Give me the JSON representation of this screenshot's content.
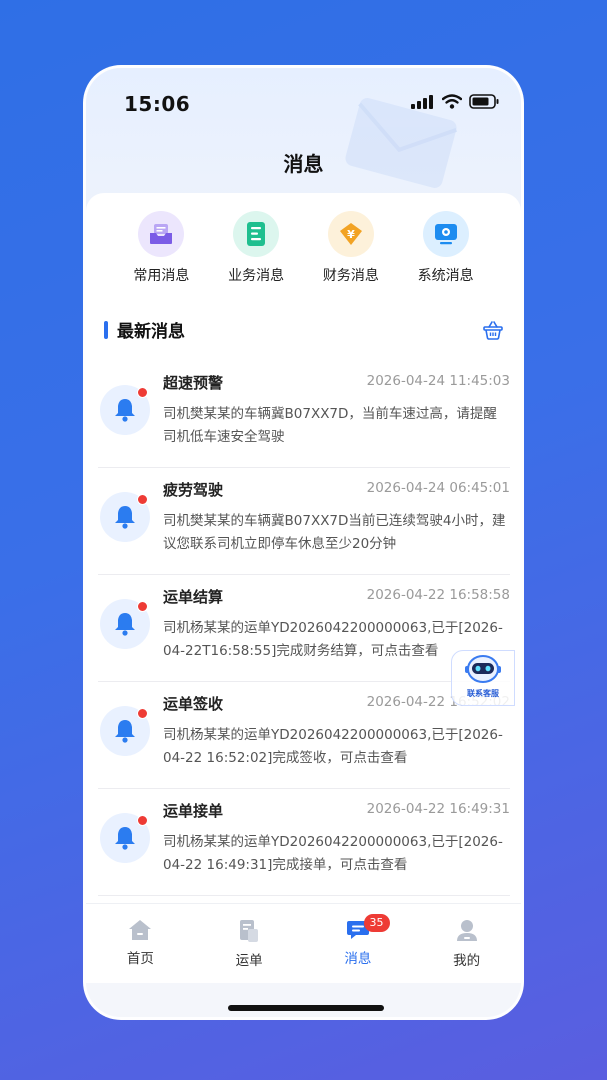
{
  "status_bar": {
    "time": "15:06"
  },
  "header": {
    "title": "消息"
  },
  "categories": [
    {
      "label": "常用消息",
      "icon": "inbox-icon",
      "color": "#7b5ce6"
    },
    {
      "label": "业务消息",
      "icon": "document-icon",
      "color": "#1fbf8f"
    },
    {
      "label": "财务消息",
      "icon": "yen-icon",
      "color": "#f2a324"
    },
    {
      "label": "系统消息",
      "icon": "monitor-icon",
      "color": "#1d8cf0"
    }
  ],
  "section": {
    "title": "最新消息"
  },
  "messages": [
    {
      "title": "超速预警",
      "time": "2026-04-24 11:45:03",
      "body": "司机樊某某的车辆冀B07XX7D，当前车速过高，请提醒司机低车速安全驾驶"
    },
    {
      "title": "疲劳驾驶",
      "time": "2026-04-24 06:45:01",
      "body": "司机樊某某的车辆冀B07XX7D当前已连续驾驶4小时，建议您联系司机立即停车休息至少20分钟"
    },
    {
      "title": "运单结算",
      "time": "2026-04-22 16:58:58",
      "body": "司机杨某某的运单YD2026042200000063,已于[2026-04-22T16:58:55]完成财务结算，可点击查看"
    },
    {
      "title": "运单签收",
      "time": "2026-04-22 16:52:02",
      "body": "司机杨某某的运单YD2026042200000063,已于[2026-04-22 16:52:02]完成签收，可点击查看"
    },
    {
      "title": "运单接单",
      "time": "2026-04-22 16:49:31",
      "body": "司机杨某某的运单YD2026042200000063,已于[2026-04-22 16:49:31]完成接单，可点击查看"
    }
  ],
  "assistant": {
    "label": "联系客服"
  },
  "tabbar": {
    "tabs": [
      {
        "label": "首页"
      },
      {
        "label": "运单"
      },
      {
        "label": "消息",
        "badge": "35"
      },
      {
        "label": "我的"
      }
    ]
  },
  "colors": {
    "accent": "#2a6fee",
    "badge": "#ee3b35"
  }
}
